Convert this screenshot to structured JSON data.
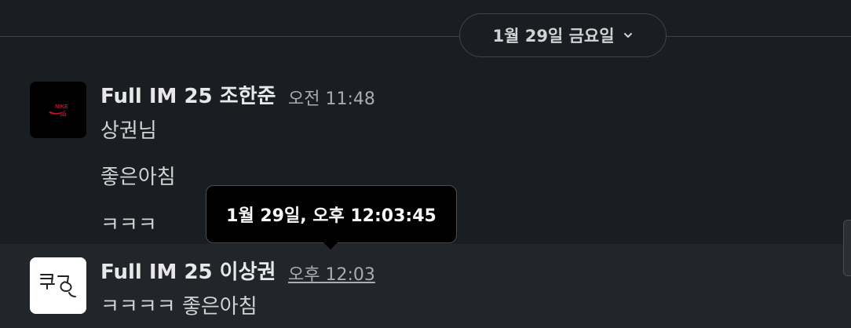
{
  "date_divider": {
    "label": "1월 29일 금요일",
    "icon": "chevron-down-icon"
  },
  "messages": [
    {
      "sender": "Full IM 25 조한준",
      "time": "오전 11:48",
      "avatar_icon": "nike-sb-logo-avatar",
      "lines": [
        "상권님",
        "좋은아침",
        "ㅋㅋㅋ"
      ]
    },
    {
      "sender": "Full IM 25 이상권",
      "time": "오후 12:03",
      "avatar_icon": "handwritten-avatar",
      "lines": [
        "ㅋㅋㅋㅋ 좋은아침"
      ]
    }
  ],
  "tooltip": {
    "text": "1월 29일, 오후 12:03:45"
  },
  "colors": {
    "background": "#1a1d21",
    "hover_row": "#222529",
    "tooltip_bg": "#000000",
    "nike_red": "#c8102e"
  }
}
